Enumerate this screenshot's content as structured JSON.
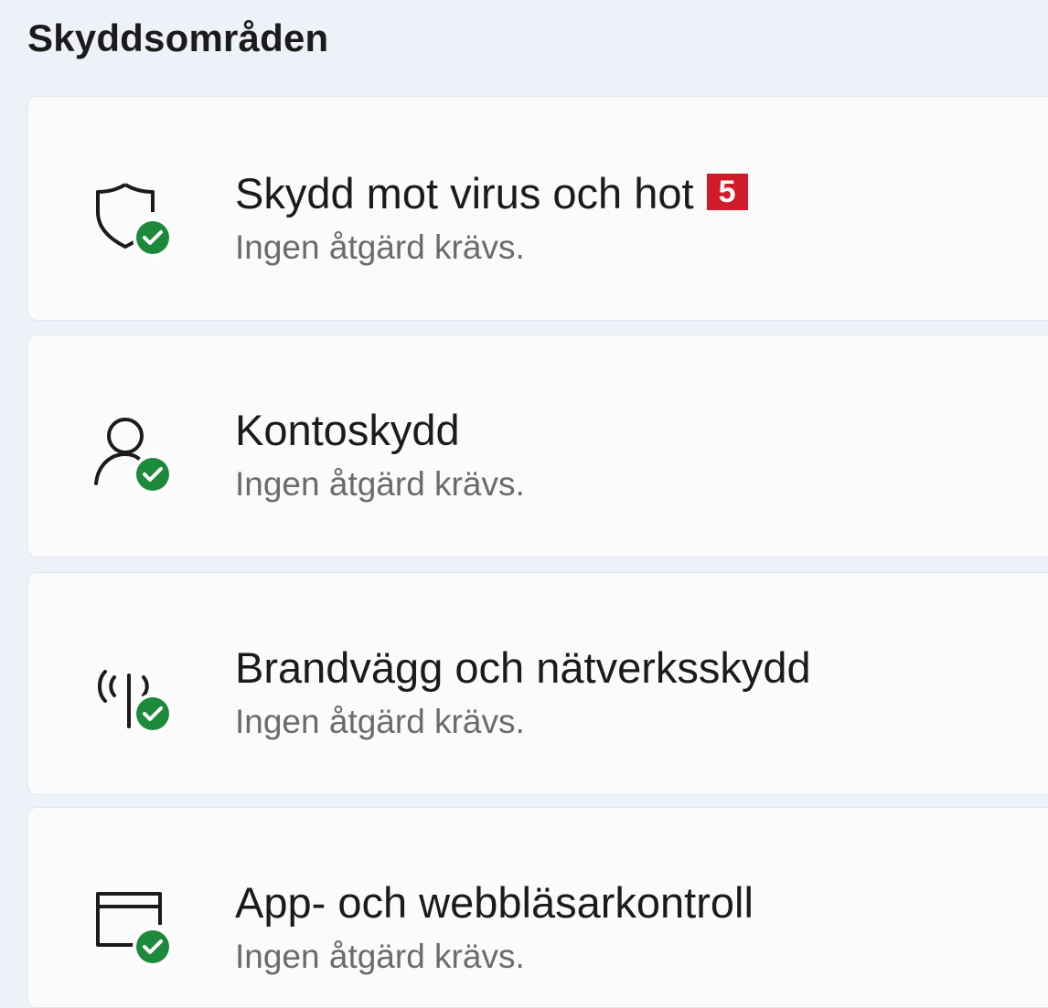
{
  "section": {
    "title": "Skyddsområden"
  },
  "areas": [
    {
      "title": "Skydd mot virus och hot",
      "status": "Ingen åtgärd krävs.",
      "icon": "shield-icon",
      "marker": "5"
    },
    {
      "title": "Kontoskydd",
      "status": "Ingen åtgärd krävs.",
      "icon": "account-icon"
    },
    {
      "title": "Brandvägg och nätverksskydd",
      "status": "Ingen åtgärd krävs.",
      "icon": "firewall-network-icon"
    },
    {
      "title": "App- och webbläsarkontroll",
      "status": "Ingen åtgärd krävs.",
      "icon": "app-browser-icon"
    }
  ],
  "colors": {
    "status_ok": "#1c8a3a",
    "marker": "#d11a2a"
  }
}
